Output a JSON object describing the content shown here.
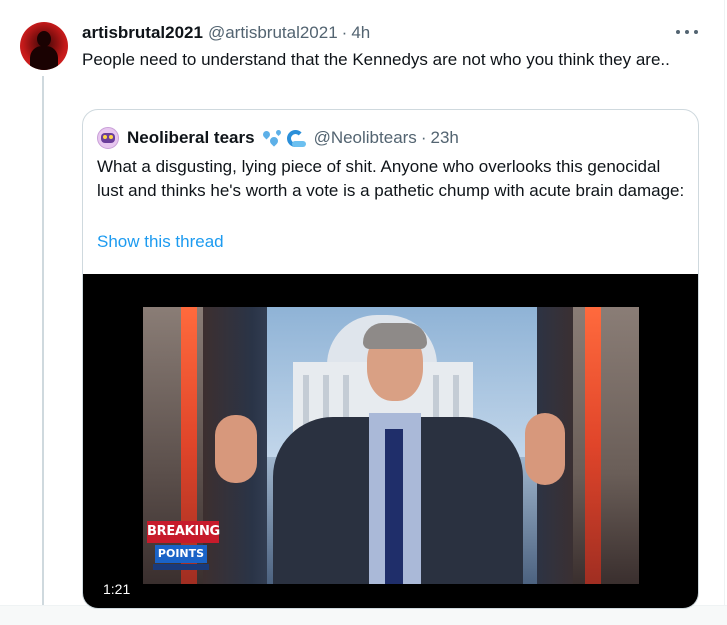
{
  "tweet": {
    "author_name": "artisbrutal2021",
    "author_handle": "@artisbrutal2021",
    "separator": "·",
    "time": "4h",
    "text": "People need to understand that the Kennedys are not who you think they are.."
  },
  "quote": {
    "author_name": "Neoliberal tears",
    "name_emojis": [
      "sweat-droplets-icon",
      "water-wave-icon"
    ],
    "author_handle": "@Neolibtears",
    "separator": "·",
    "time": "23h",
    "text": "What a disgusting, lying piece of shit. Anyone who overlooks this genocidal lust and thinks he's worth a vote is a pathetic chump with acute brain damage:",
    "show_thread_label": "Show this thread",
    "video": {
      "duration": "1:21",
      "overlay_top": "BREAKING",
      "overlay_bottom": "POINTS"
    }
  },
  "colors": {
    "text": "#0f1419",
    "secondary": "#536471",
    "link": "#1d9bf0",
    "border": "#cfd9de"
  }
}
